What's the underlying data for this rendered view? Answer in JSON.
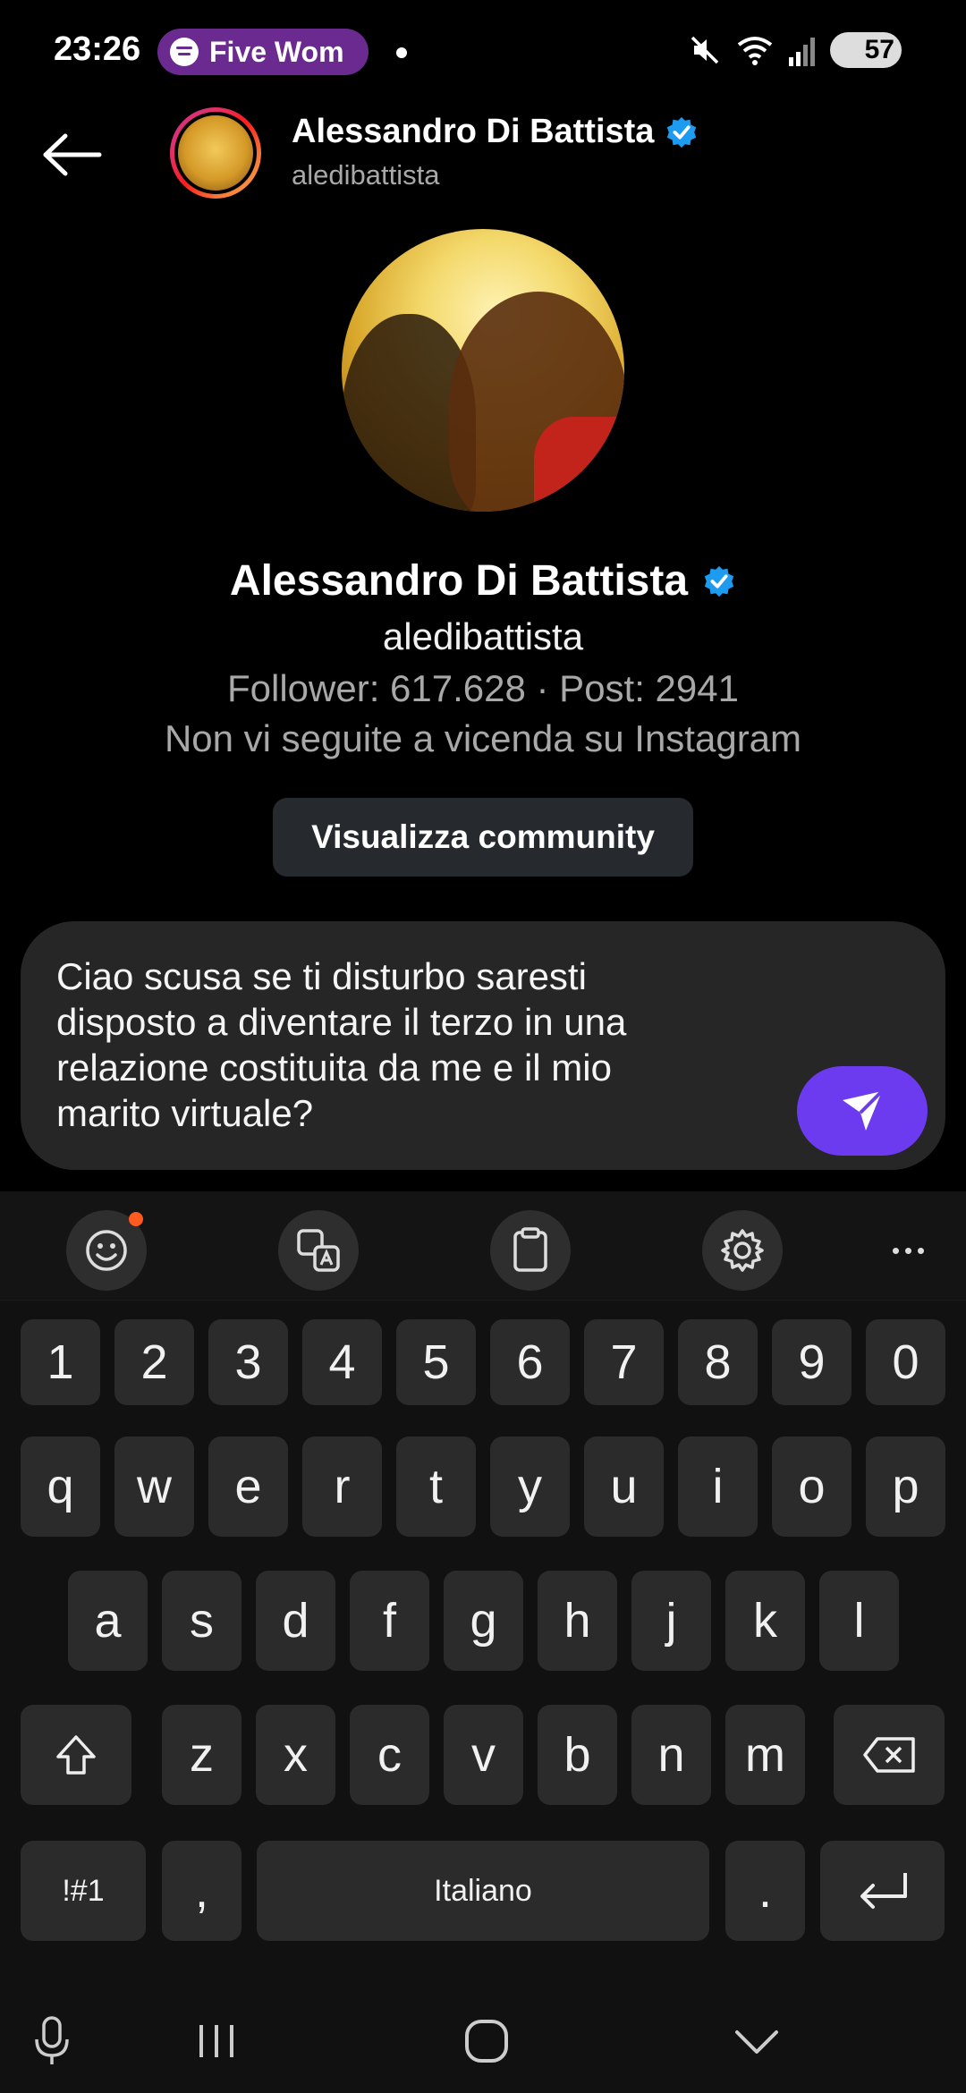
{
  "status_bar": {
    "time": "23:26",
    "now_playing": "Five Wom",
    "battery": "57"
  },
  "header": {
    "name": "Alessandro Di Battista",
    "username": "aledibattista"
  },
  "profile": {
    "name": "Alessandro Di Battista",
    "username": "aledibattista",
    "stats": "Follower: 617.628 · Post: 2941",
    "relation": "Non vi seguite a vicenda su Instagram",
    "community_button": "Visualizza community"
  },
  "composer": {
    "text": "Ciao scusa se ti disturbo saresti\ndisposto a diventare il terzo in una\nrelazione costituita da me e il mio\nmarito virtuale?"
  },
  "keyboard": {
    "row_numbers": [
      "1",
      "2",
      "3",
      "4",
      "5",
      "6",
      "7",
      "8",
      "9",
      "0"
    ],
    "row_1": [
      "q",
      "w",
      "e",
      "r",
      "t",
      "y",
      "u",
      "i",
      "o",
      "p"
    ],
    "row_2": [
      "a",
      "s",
      "d",
      "f",
      "g",
      "h",
      "j",
      "k",
      "l"
    ],
    "row_3": [
      "z",
      "x",
      "c",
      "v",
      "b",
      "n",
      "m"
    ],
    "symbols_key": "!#1",
    "comma_key": ",",
    "space_key": "Italiano",
    "period_key": "."
  },
  "colors": {
    "accent": "#6c3bf0",
    "verified": "#1d9bf0",
    "spotify_pill": "#6b2a8f"
  }
}
